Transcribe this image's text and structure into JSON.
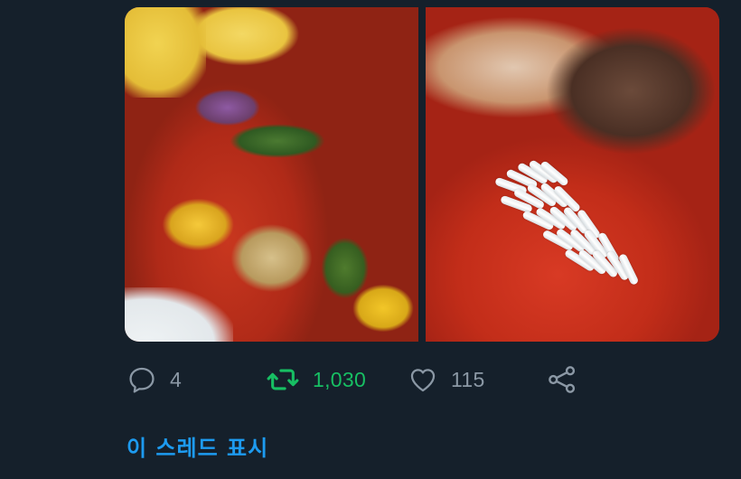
{
  "tweet": {
    "media": [
      {
        "name": "photo-pizza"
      },
      {
        "name": "photo-closeup"
      }
    ],
    "actions": {
      "reply": {
        "icon": "reply-icon",
        "count": "4"
      },
      "retweet": {
        "icon": "retweet-icon",
        "count": "1,030",
        "color": "#17bf63"
      },
      "like": {
        "icon": "heart-icon",
        "count": "115"
      },
      "share": {
        "icon": "share-icon"
      }
    },
    "show_thread_label": "이 스레드 표시"
  },
  "colors": {
    "background": "#15202b",
    "muted": "#8b98a5",
    "link": "#1d9bf0",
    "retweet": "#17bf63"
  }
}
